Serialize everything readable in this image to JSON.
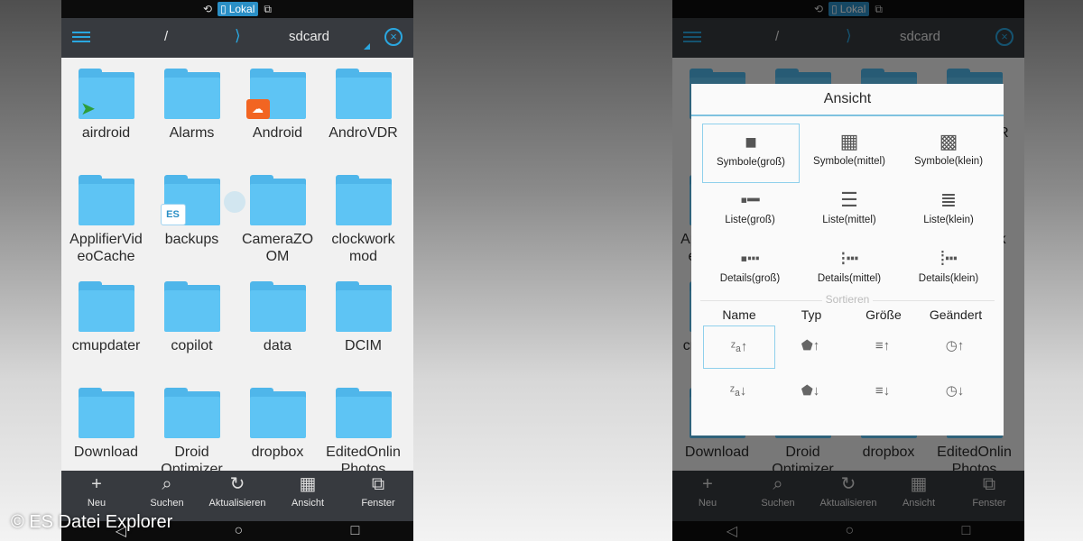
{
  "status": {
    "glyph_left": "⟲",
    "lokal": "Lokal",
    "lokal_icon": "▯",
    "glyph_right": "⧉"
  },
  "titlebar": {
    "root_path": "/",
    "separator": "⟩",
    "current": "sdcard",
    "close_glyph": "×"
  },
  "folders": [
    "airdroid",
    "Alarms",
    "Android",
    "AndroVDR",
    "ApplifierVideoCache",
    "backups",
    "CameraZOOM",
    "clockwork mod",
    "cmupdater",
    "copilot",
    "data",
    "DCIM",
    "Download",
    "Droid Optimizer",
    "dropbox",
    "EditedOnlinePhotos"
  ],
  "folder_labels": [
    "airdroid",
    "Alarms",
    "Android",
    "AndroVDR",
    "ApplifierVid\neoCache",
    "backups",
    "CameraZO\nOM",
    "clockwork\nmod",
    "cmupdater",
    "copilot",
    "data",
    "DCIM",
    "Download",
    "Droid\nOptimizer",
    "dropbox",
    "EditedOnlin\nPhotos"
  ],
  "badges": {
    "airdroid": "➤",
    "android": "☁",
    "backups": "ES"
  },
  "toolbar": [
    {
      "label": "Neu",
      "icon": "+"
    },
    {
      "label": "Suchen",
      "icon": "⌕"
    },
    {
      "label": "Aktualisieren",
      "icon": "↻"
    },
    {
      "label": "Ansicht",
      "icon": "▦"
    },
    {
      "label": "Fenster",
      "icon": "⧉"
    }
  ],
  "navbar": [
    "◁",
    "○",
    "□"
  ],
  "dialog": {
    "title": "Ansicht",
    "view_options": [
      {
        "label": "Symbole(groß)",
        "icon": "■",
        "selected": true
      },
      {
        "label": "Symbole(mittel)",
        "icon": "▦",
        "selected": false
      },
      {
        "label": "Symbole(klein)",
        "icon": "▩",
        "selected": false
      },
      {
        "label": "Liste(groß)",
        "icon": "▪━",
        "selected": false
      },
      {
        "label": "Liste(mittel)",
        "icon": "☰",
        "selected": false
      },
      {
        "label": "Liste(klein)",
        "icon": "≣",
        "selected": false
      },
      {
        "label": "Details(groß)",
        "icon": "▪┅",
        "selected": false
      },
      {
        "label": "Details(mittel)",
        "icon": "⁝┅",
        "selected": false
      },
      {
        "label": "Details(klein)",
        "icon": "⁞┅",
        "selected": false
      }
    ],
    "sort_title": "Sortieren",
    "sort_columns": [
      "Name",
      "Typ",
      "Größe",
      "Geändert"
    ],
    "sort_asc_icons": [
      "ᶻₐ↑",
      "⬟↑",
      "≡↑",
      "◷↑"
    ],
    "sort_desc_icons": [
      "ᶻₐ↓",
      "⬟↓",
      "≡↓",
      "◷↓"
    ]
  },
  "watermark": "© ES Datei Explorer"
}
